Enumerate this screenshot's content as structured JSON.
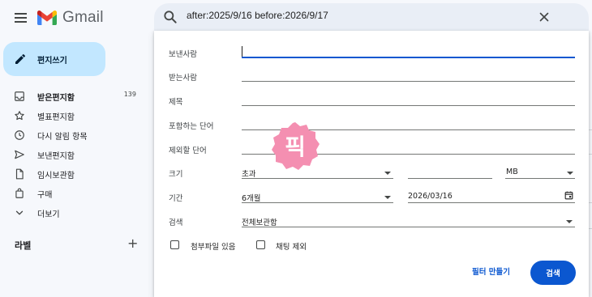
{
  "app": {
    "name": "Gmail"
  },
  "search": {
    "query": "after:2025/9/16 before:2026/9/17"
  },
  "sidebar": {
    "compose_label": "편지쓰기",
    "items": [
      {
        "label": "받은편지함",
        "count": "139",
        "icon": "inbox-icon"
      },
      {
        "label": "별표편지함",
        "count": "",
        "icon": "star-icon"
      },
      {
        "label": "다시 알림 항목",
        "count": "",
        "icon": "clock-icon"
      },
      {
        "label": "보낸편지함",
        "count": "",
        "icon": "send-icon"
      },
      {
        "label": "임시보관함",
        "count": "",
        "icon": "draft-icon"
      },
      {
        "label": "구매",
        "count": "",
        "icon": "shopping-bag-icon"
      },
      {
        "label": "더보기",
        "count": "",
        "icon": "chevron-down-icon"
      }
    ],
    "labels_title": "라벨",
    "labels_add": "+"
  },
  "filter": {
    "from_label": "보낸사람",
    "from_value": "",
    "to_label": "받는사람",
    "to_value": "",
    "subject_label": "제목",
    "subject_value": "",
    "has_words_label": "포함하는 단어",
    "has_words_value": "",
    "doesnt_have_label": "제외할 단어",
    "doesnt_have_value": "",
    "size_label": "크기",
    "size_operator": "초과",
    "size_value": "",
    "size_unit": "MB",
    "date_label": "기간",
    "date_range": "6개월",
    "date_value": "2026/03/16",
    "search_in_label": "검색",
    "search_in_value": "전체보관함",
    "has_attachment_label": "첨부파일 있음",
    "exclude_chats_label": "채팅 제외",
    "create_filter_label": "필터 만들기",
    "search_button_label": "검색"
  },
  "watermark": {
    "text": "픽",
    "color": "#f48fb1"
  },
  "colors": {
    "accent": "#0b57d0",
    "compose_bg": "#c2e7ff",
    "page_bg": "#f6f8fc"
  }
}
